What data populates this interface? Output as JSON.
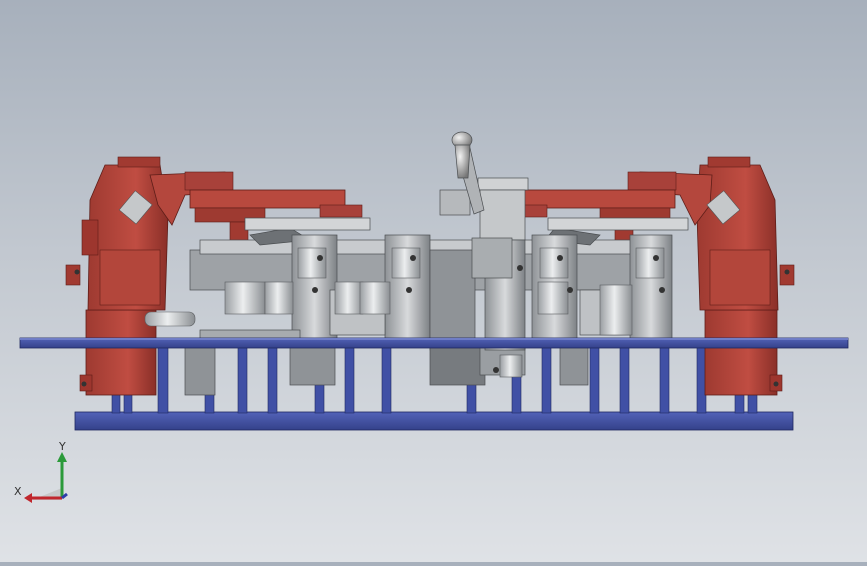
{
  "viewport": {
    "background_top": "#a7b0bc",
    "background_bottom": "#dfe2e6",
    "model_colors": {
      "clamp_red": "#b5463c",
      "clamp_red_dark": "#8c2f27",
      "base_blue": "#3f4fa0",
      "base_blue_dark": "#2c3877",
      "steel": "#b9bcbf",
      "steel_dark": "#6f7377",
      "cylinder": "#cfd2d4"
    }
  },
  "triad": {
    "x_label": "X",
    "y_label": "Y",
    "x_color": "#c0262d",
    "y_color": "#2b9a3a",
    "z_color": "#2c3ea8"
  }
}
